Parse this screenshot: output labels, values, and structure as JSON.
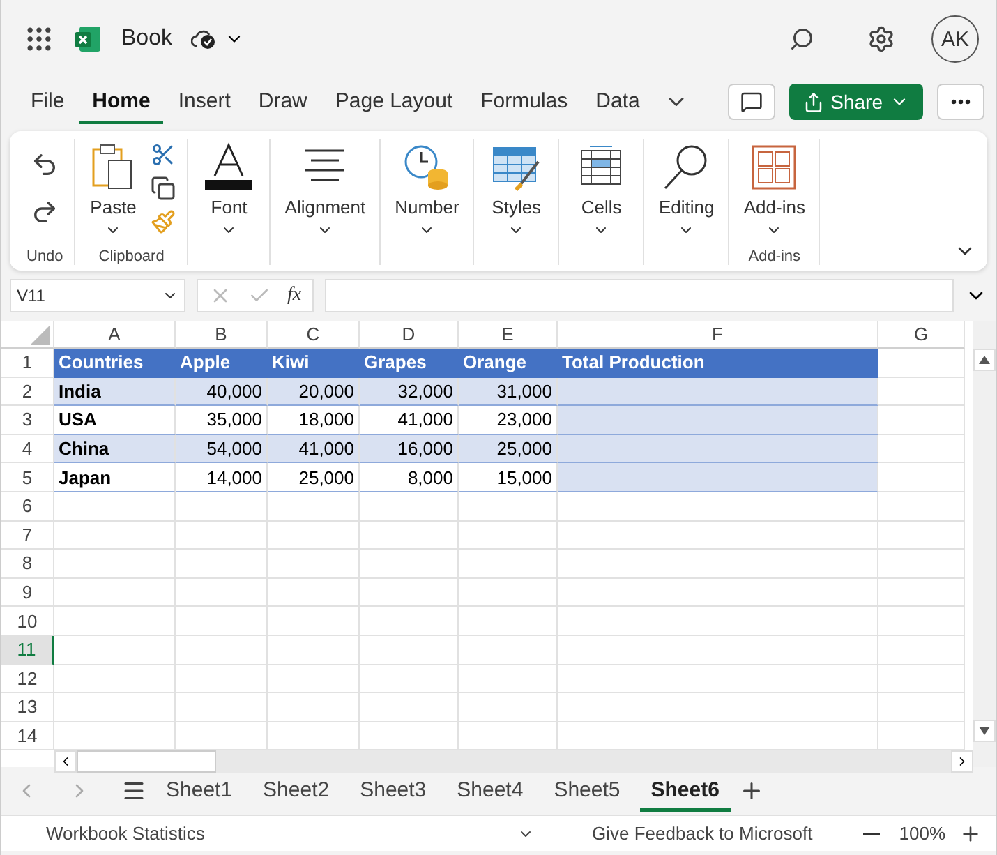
{
  "app_bar": {
    "title": "Book",
    "avatar": "AK"
  },
  "menu_tabs": [
    {
      "label": "File",
      "selected": false
    },
    {
      "label": "Home",
      "selected": true
    },
    {
      "label": "Insert",
      "selected": false
    },
    {
      "label": "Draw",
      "selected": false
    },
    {
      "label": "Page Layout",
      "selected": false
    },
    {
      "label": "Formulas",
      "selected": false
    },
    {
      "label": "Data",
      "selected": false
    }
  ],
  "share_button": "Share",
  "ribbon": [
    {
      "kind": "undo",
      "label": "Undo"
    },
    {
      "kind": "clipboard",
      "button": "Paste",
      "label": "Clipboard"
    },
    {
      "kind": "font",
      "button": "Font"
    },
    {
      "kind": "alignment",
      "button": "Alignment"
    },
    {
      "kind": "number",
      "button": "Number"
    },
    {
      "kind": "styles",
      "button": "Styles"
    },
    {
      "kind": "cells",
      "button": "Cells"
    },
    {
      "kind": "editing",
      "button": "Editing"
    },
    {
      "kind": "addins",
      "button": "Add-ins",
      "label": "Add-ins"
    }
  ],
  "formula_bar": {
    "name_box": "V11",
    "function_label": "fx"
  },
  "table": {
    "columns": [
      "A",
      "B",
      "C",
      "D",
      "E",
      "F",
      "G"
    ],
    "rows": [
      {
        "number": "1",
        "kind": "header",
        "selected": false,
        "cells": [
          "Countries",
          "Apple",
          "Kiwi",
          "Grapes",
          "Orange",
          "Total Production"
        ]
      },
      {
        "number": "2",
        "kind": "data",
        "selected": false,
        "banded": true,
        "range_selected": true,
        "cells": [
          "India",
          "40,000",
          "20,000",
          "32,000",
          "31,000"
        ]
      },
      {
        "number": "3",
        "kind": "data",
        "selected": false,
        "banded": false,
        "range_selected": true,
        "cells": [
          "USA",
          "35,000",
          "18,000",
          "41,000",
          "23,000"
        ]
      },
      {
        "number": "4",
        "kind": "data",
        "selected": false,
        "banded": true,
        "range_selected": true,
        "cells": [
          "China",
          "54,000",
          "41,000",
          "16,000",
          "25,000"
        ]
      },
      {
        "number": "5",
        "kind": "data",
        "selected": false,
        "banded": false,
        "range_selected": true,
        "cells": [
          "Japan",
          "14,000",
          "25,000",
          "8,000",
          "15,000"
        ]
      },
      {
        "number": "6",
        "kind": "empty",
        "selected": false
      },
      {
        "number": "7",
        "kind": "empty",
        "selected": false
      },
      {
        "number": "8",
        "kind": "empty",
        "selected": false
      },
      {
        "number": "9",
        "kind": "empty",
        "selected": false
      },
      {
        "number": "10",
        "kind": "empty",
        "selected": false
      },
      {
        "number": "11",
        "kind": "empty",
        "selected": true
      },
      {
        "number": "12",
        "kind": "empty",
        "selected": false
      },
      {
        "number": "13",
        "kind": "empty",
        "selected": false
      },
      {
        "number": "14",
        "kind": "empty",
        "selected": false
      }
    ]
  },
  "sheet_tabs": [
    {
      "label": "Sheet1",
      "selected": false
    },
    {
      "label": "Sheet2",
      "selected": false
    },
    {
      "label": "Sheet3",
      "selected": false
    },
    {
      "label": "Sheet4",
      "selected": false
    },
    {
      "label": "Sheet5",
      "selected": false
    },
    {
      "label": "Sheet6",
      "selected": true
    }
  ],
  "status_bar": {
    "left": "Workbook Statistics",
    "feedback": "Give Feedback to Microsoft",
    "zoom": "100%"
  }
}
